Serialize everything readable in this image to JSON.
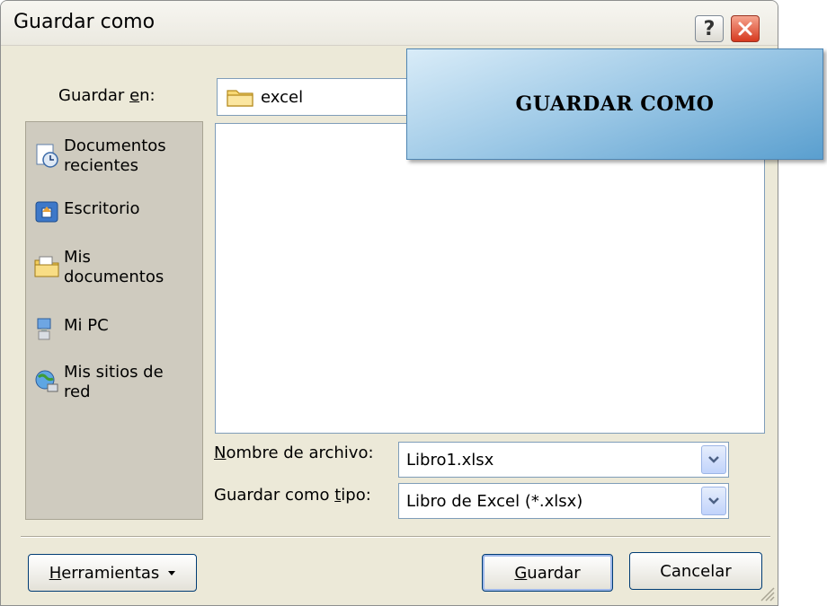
{
  "window": {
    "title": "Guardar como"
  },
  "titlebar": {
    "help_label": "?"
  },
  "lookin": {
    "label_pre": "Guardar ",
    "label_key": "e",
    "label_post": "n:",
    "value": "excel"
  },
  "places": [
    {
      "line1": "Documentos",
      "line2": "recientes",
      "icon": "recent-documents-icon"
    },
    {
      "line1": "Escritorio",
      "line2": "",
      "icon": "desktop-icon"
    },
    {
      "line1": "Mis",
      "line2": "documentos",
      "icon": "my-documents-icon"
    },
    {
      "line1": "Mi PC",
      "line2": "",
      "icon": "my-computer-icon"
    },
    {
      "line1": "Mis sitios de",
      "line2": "red",
      "icon": "network-places-icon"
    }
  ],
  "callout": {
    "text": "GUARDAR COMO"
  },
  "filename": {
    "label_key": "N",
    "label_post": "ombre de archivo:",
    "value": "Libro1.xlsx"
  },
  "filetype": {
    "label_pre": "Guardar como ",
    "label_key": "t",
    "label_post": "ipo:",
    "value": "Libro de Excel (*.xlsx)"
  },
  "buttons": {
    "tools_key": "H",
    "tools_rest": "erramientas",
    "save_key": "G",
    "save_rest": "uardar",
    "cancel": "Cancelar"
  },
  "colors": {
    "dialog_bg": "#ece9d8",
    "callout_blue": "#5a9fcf",
    "close_red": "#d6391f"
  }
}
